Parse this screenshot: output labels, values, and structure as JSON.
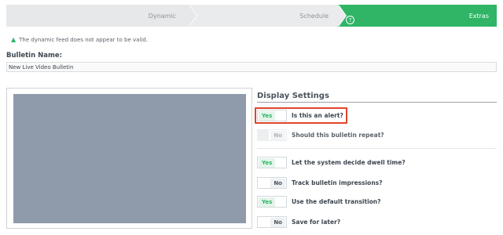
{
  "wizard": {
    "steps": [
      {
        "label": "Dynamic",
        "state": "inactive"
      },
      {
        "label": "Schedule",
        "state": "inactive"
      },
      {
        "label": "Extras",
        "state": "active"
      }
    ],
    "help_glyph": "?"
  },
  "warning": {
    "icon": "warning-triangle-icon",
    "text": "The dynamic feed does not appear to be valid."
  },
  "bulletin_name": {
    "label": "Bulletin Name:",
    "value": "New Live Video Bulletin"
  },
  "display_settings": {
    "title": "Display Settings",
    "rows": [
      {
        "toggle": "Yes",
        "label": "Is this an alert?"
      },
      {
        "toggle": "No",
        "label": "Should this bulletin repeat?"
      },
      {
        "toggle": "Yes",
        "label": "Let the system decide dwell time?"
      },
      {
        "toggle": "No",
        "label": "Track bulletin impressions?"
      },
      {
        "toggle": "Yes",
        "label": "Use the default transition?"
      },
      {
        "toggle": "No",
        "label": "Save for later?"
      }
    ]
  },
  "colors": {
    "accent_green": "#2fb565",
    "highlight_red": "#e0452b",
    "preview_fill": "#8f9aab"
  }
}
